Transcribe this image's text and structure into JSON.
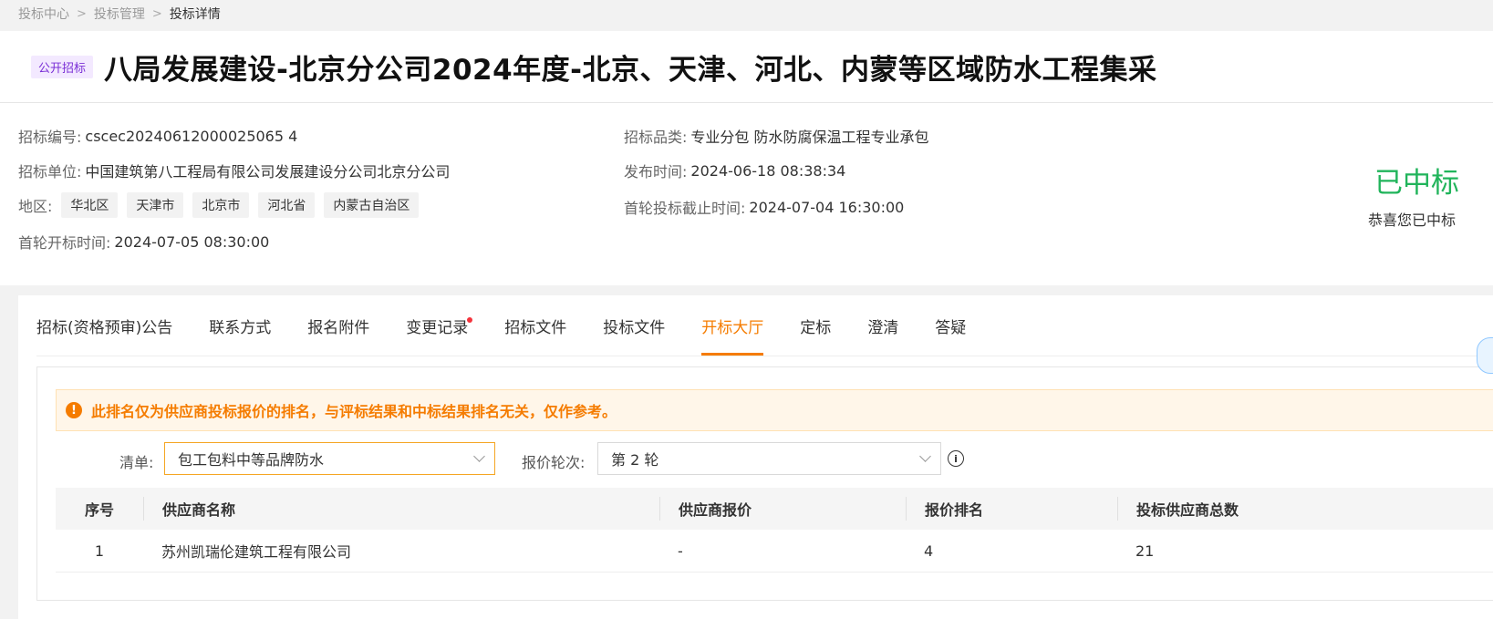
{
  "breadcrumb": [
    "投标中心",
    "投标管理",
    "投标详情"
  ],
  "header": {
    "tag": "公开招标",
    "title": "八局发展建设-北京分公司2024年度-北京、天津、河北、内蒙等区域防水工程集采"
  },
  "info": {
    "bid_no_label": "招标编号:",
    "bid_no": "cscec20240612000025065 4",
    "unit_label": "招标单位:",
    "unit": "中国建筑第八工程局有限公司发展建设分公司北京分公司",
    "region_label": "地区:",
    "regions": [
      "华北区",
      "天津市",
      "北京市",
      "河北省",
      "内蒙古自治区"
    ],
    "open_time_label": "首轮开标时间:",
    "open_time": "2024-07-05 08:30:00",
    "category_label": "招标品类:",
    "category": "专业分包 防水防腐保温工程专业承包",
    "publish_label": "发布时间:",
    "publish_time": "2024-06-18 08:38:34",
    "deadline_label": "首轮投标截止时间:",
    "deadline": "2024-07-04 16:30:00"
  },
  "status": {
    "main": "已中标",
    "sub": "恭喜您已中标"
  },
  "tabs": [
    "招标(资格预审)公告",
    "联系方式",
    "报名附件",
    "变更记录",
    "招标文件",
    "投标文件",
    "开标大厅",
    "定标",
    "澄清",
    "答疑"
  ],
  "notice": "此排名仅为供应商投标报价的排名，与评标结果和中标结果排名无关，仅作参考。",
  "filters": {
    "list_label": "清单:",
    "list_value": "包工包料中等品牌防水",
    "round_label": "报价轮次:",
    "round_value": "第 2 轮"
  },
  "table": {
    "headers": [
      "序号",
      "供应商名称",
      "供应商报价",
      "报价排名",
      "投标供应商总数"
    ],
    "rows": [
      [
        "1",
        "苏州凯瑞伦建筑工程有限公司",
        "-",
        "4",
        "21"
      ]
    ]
  }
}
